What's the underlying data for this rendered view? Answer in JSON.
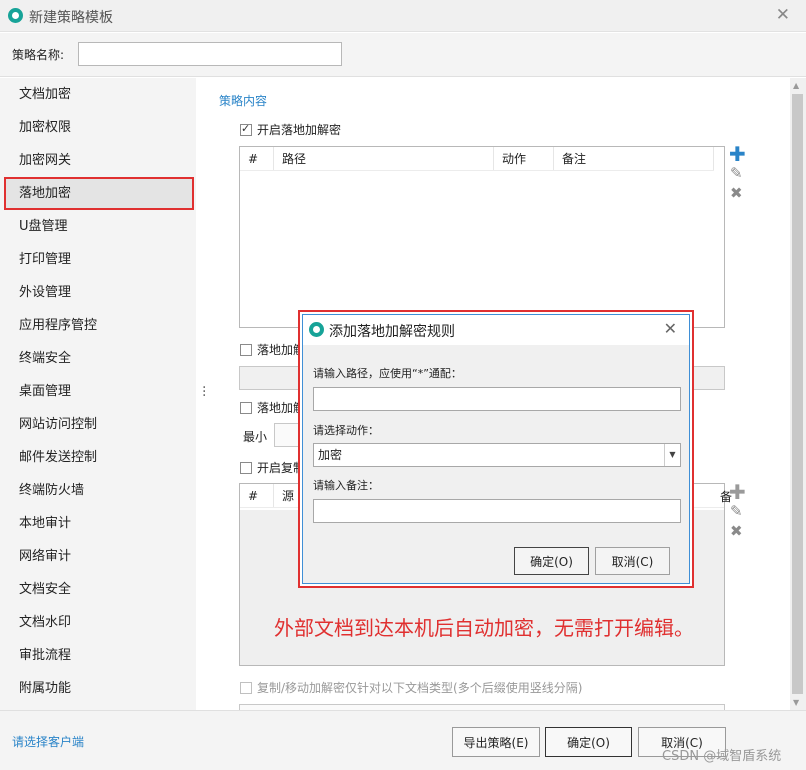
{
  "window": {
    "title": "新建策略模板"
  },
  "name_row": {
    "label": "策略名称:",
    "value": ""
  },
  "sidebar": {
    "items": [
      {
        "label": "文档加密"
      },
      {
        "label": "加密权限"
      },
      {
        "label": "加密网关"
      },
      {
        "label": "落地加密",
        "active": true
      },
      {
        "label": "U盘管理"
      },
      {
        "label": "打印管理"
      },
      {
        "label": "外设管理"
      },
      {
        "label": "应用程序管控"
      },
      {
        "label": "终端安全"
      },
      {
        "label": "桌面管理"
      },
      {
        "label": "网站访问控制"
      },
      {
        "label": "邮件发送控制"
      },
      {
        "label": "终端防火墙"
      },
      {
        "label": "本地审计"
      },
      {
        "label": "网络审计"
      },
      {
        "label": "文档安全"
      },
      {
        "label": "文档水印"
      },
      {
        "label": "审批流程"
      },
      {
        "label": "附属功能"
      }
    ]
  },
  "content": {
    "section_title": "策略内容",
    "enable_landing": {
      "label": "开启落地加解密",
      "checked": true
    },
    "table1": {
      "columns": [
        "#",
        "路径",
        "动作",
        "备注"
      ]
    },
    "partial_check1": "落地加解",
    "partial_check2": "落地加解",
    "min_label": "最小",
    "partial_check3": "开启复制",
    "table2": {
      "columns": [
        "#",
        "源"
      ],
      "tail_fragment": "备"
    },
    "copy_move_check": {
      "label": "复制/移动加解密仅针对以下文档类型(多个后缀使用竖线分隔)",
      "checked": false
    }
  },
  "icons": {
    "add": "plus-icon",
    "edit": "pencil-icon",
    "delete": "x-icon"
  },
  "dialog": {
    "title": "添加落地加解密规则",
    "path_label": "请输入路径，应使用“*”通配：",
    "path_value": "",
    "action_label": "请选择动作：",
    "action_value": "加密",
    "note_label": "请输入备注：",
    "note_value": "",
    "ok": "确定(O)",
    "cancel": "取消(C)"
  },
  "annotation": "外部文档到达本机后自动加密，无需打开编辑。",
  "footer": {
    "client_link": "请选择客户端",
    "export": "导出策略(E)",
    "ok": "确定(O)",
    "cancel": "取消(C)",
    "watermark": "CSDN @域智盾系统"
  },
  "colors": {
    "accent": "#2a84c8",
    "highlight": "#e03030",
    "logo": "#17a398"
  }
}
